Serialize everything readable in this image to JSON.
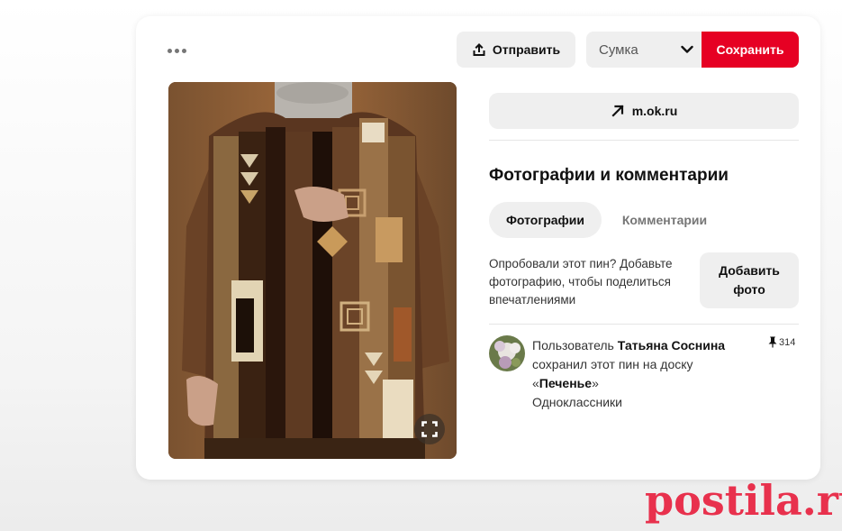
{
  "toolbar": {
    "more_icon": "more-horizontal-icon",
    "send_label": "Отправить",
    "send_icon": "share-upload-icon",
    "board_selected": "Сумка",
    "save_label": "Сохранить",
    "save_color": "#e60023"
  },
  "source": {
    "label": "m.ok.ru",
    "icon": "external-arrow-icon"
  },
  "photos_section": {
    "title": "Фотографии и комментарии",
    "tabs": [
      {
        "label": "Фотографии",
        "active": true
      },
      {
        "label": "Комментарии",
        "active": false
      }
    ],
    "tried_text": "Опробовали этот пин? Добавьте фотографию, чтобы поделиться впечатлениями",
    "add_photo_label": "Добавить фото"
  },
  "saved_by": {
    "prefix": "Пользователь ",
    "user_name": "Татьяна Соснина",
    "middle": "сохранил этот пин на доску",
    "quote_open": "«",
    "board_name": "Печенье",
    "quote_close": "»",
    "site": "Одноклассники",
    "pin_count": "314",
    "pin_icon": "pushpin-icon"
  },
  "image": {
    "expand_icon": "expand-icon"
  },
  "watermark": {
    "text": "postila.ru"
  }
}
